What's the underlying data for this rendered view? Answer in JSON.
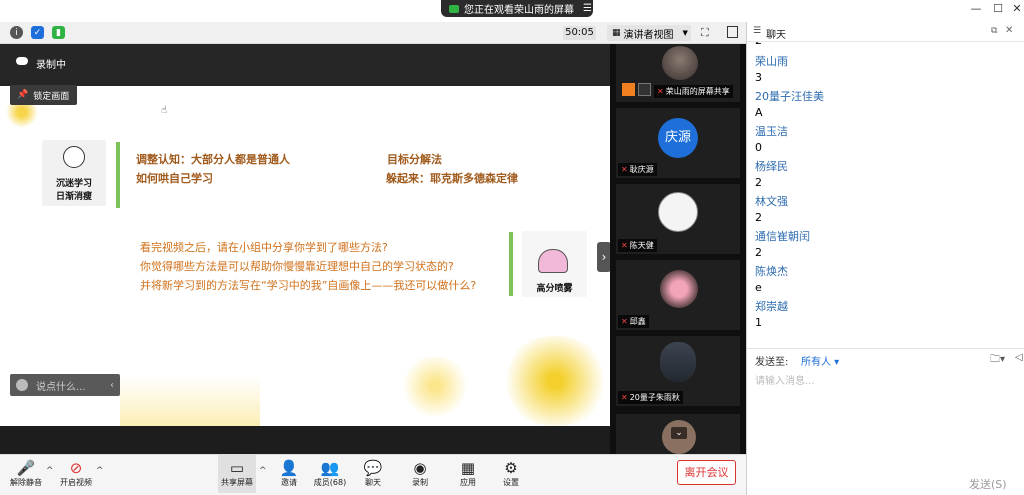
{
  "screen_share_banner": "您正在观看荣山雨的屏幕",
  "meeting_bar": {
    "timer": "50:05",
    "view_mode": "演讲者视图"
  },
  "share": {
    "recording": "录制中",
    "lock_screen": "锁定画面",
    "say_placeholder": "说点什么..."
  },
  "slide": {
    "tag_left": [
      "沉迷学习",
      "日渐消瘦"
    ],
    "points": [
      "调整认知：大部分人都是普通人",
      "如何哄自己学习",
      "目标分解法",
      "躲起来：耶克斯多德森定律"
    ],
    "questions": [
      "看完视频之后，请在小组中分享你学到了哪些方法?",
      "你觉得哪些方法是可以帮助你慢慢靠近理想中自己的学习状态的?",
      "并将新学习到的方法写在“学习中的我”自画像上——我还可以做什么?"
    ],
    "tag_right": "高分喷雾"
  },
  "participants": [
    {
      "name": "荣山雨的屏幕共享",
      "avatar": "photo"
    },
    {
      "name": "耿庆源",
      "avatar": "庆源"
    },
    {
      "name": "陈天健",
      "avatar": "cartoon"
    },
    {
      "name": "邱鑫",
      "avatar": "photo"
    },
    {
      "name": "20量子朱雨秋",
      "avatar": "photo"
    },
    {
      "name": "",
      "avatar": "photo"
    }
  ],
  "chat": {
    "title": "聊天",
    "messages": [
      {
        "type": "text",
        "text": "2"
      },
      {
        "type": "name",
        "text": "荣山雨"
      },
      {
        "type": "text",
        "text": "3"
      },
      {
        "type": "name",
        "text": "20量子汪佳美"
      },
      {
        "type": "text",
        "text": "A"
      },
      {
        "type": "name",
        "text": "温玉洁"
      },
      {
        "type": "text",
        "text": "0"
      },
      {
        "type": "name",
        "text": "杨绎民"
      },
      {
        "type": "text",
        "text": "2"
      },
      {
        "type": "name",
        "text": "林文强"
      },
      {
        "type": "text",
        "text": "2"
      },
      {
        "type": "name",
        "text": "通信崔朝闰"
      },
      {
        "type": "text",
        "text": "2"
      },
      {
        "type": "name",
        "text": "陈焕杰"
      },
      {
        "type": "text",
        "text": "e"
      },
      {
        "type": "name",
        "text": "郑崇越"
      },
      {
        "type": "text",
        "text": "1"
      }
    ],
    "send_to_label": "发送至:",
    "send_to_value": "所有人",
    "input_placeholder": "请输入消息...",
    "send_button": "发送(S)"
  },
  "toolbar": {
    "mute": "解除静音",
    "video": "开启视频",
    "share_screen": "共享屏幕",
    "invite": "邀请",
    "members": "成员(68)",
    "chat": "聊天",
    "record": "录制",
    "apps": "应用",
    "settings": "设置",
    "leave": "离开会议"
  }
}
